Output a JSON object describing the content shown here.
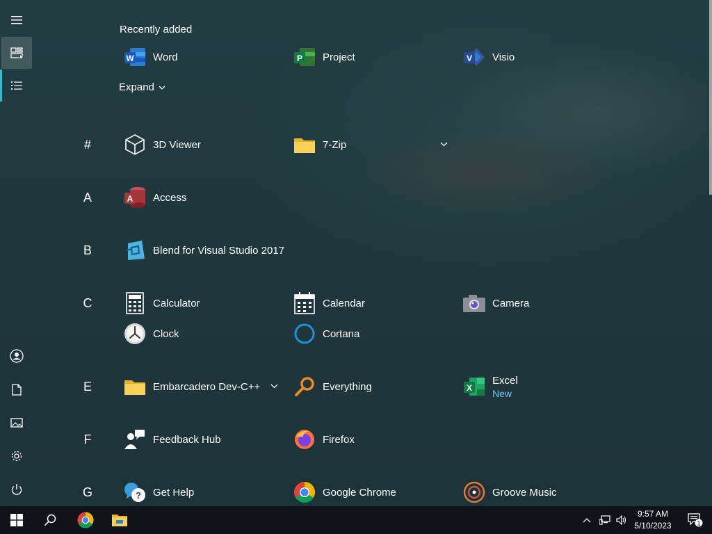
{
  "start_menu": {
    "recently_added_title": "Recently added",
    "recent_apps": [
      {
        "label": "Word",
        "icon": "word-icon"
      },
      {
        "label": "Project",
        "icon": "project-icon"
      },
      {
        "label": "Visio",
        "icon": "visio-icon"
      }
    ],
    "expand_label": "Expand",
    "letters": [
      "#",
      "A",
      "B",
      "C",
      "E",
      "F",
      "G"
    ],
    "apps": {
      "viewer3d": "3D Viewer",
      "zip7": "7-Zip",
      "access": "Access",
      "blend": "Blend for Visual Studio 2017",
      "calculator": "Calculator",
      "calendar": "Calendar",
      "camera": "Camera",
      "clock": "Clock",
      "cortana": "Cortana",
      "embarcadero": "Embarcadero Dev-C++",
      "everything": "Everything",
      "excel": "Excel",
      "excel_badge": "New",
      "feedback": "Feedback Hub",
      "firefox": "Firefox",
      "gethelp": "Get Help",
      "chrome": "Google Chrome",
      "groove": "Groove Music"
    }
  },
  "taskbar": {
    "time": "9:57 AM",
    "date": "5/10/2023",
    "notification_count": "1"
  },
  "colors": {
    "accent": "#38b8d0",
    "new_badge": "#6fc4e8",
    "taskbar": "#101418"
  }
}
